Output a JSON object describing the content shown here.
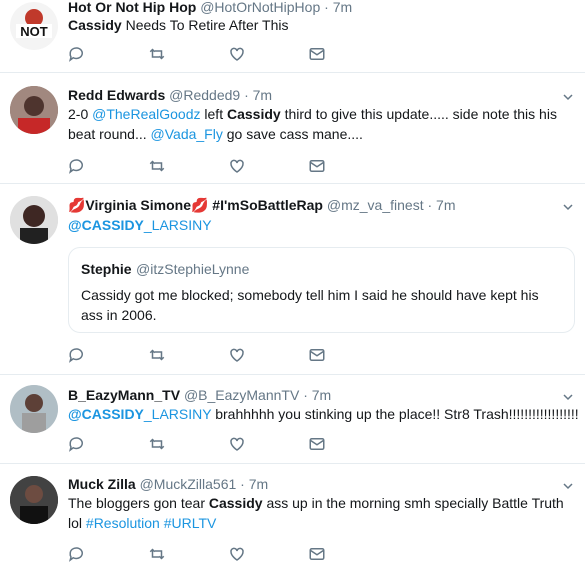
{
  "tweets": [
    {
      "name": "Hot Or Not Hip Hop",
      "handle": "@HotOrNotHipHop",
      "time": "7m",
      "avatar_text": "NOT",
      "body": [
        {
          "t": "Cassidy",
          "bold": true
        },
        {
          "t": " Needs To Retire After This"
        }
      ]
    },
    {
      "name": "Redd Edwards",
      "handle": "@Redded9",
      "time": "7m",
      "body": [
        {
          "t": "2-0 "
        },
        {
          "t": "@TheRealGoodz",
          "link": true
        },
        {
          "t": " left "
        },
        {
          "t": "Cassidy",
          "bold": true
        },
        {
          "t": " third to give this update..... side note this his beat round... "
        },
        {
          "t": "@Vada_Fly",
          "link": true
        },
        {
          "t": " go save cass mane...."
        }
      ]
    },
    {
      "name": "💋Virginia Simone💋 #I'mSoBattleRap",
      "handle": "@mz_va_finest",
      "time": "7m",
      "body": [
        {
          "t": "@CASSIDY",
          "link": true,
          "bold": true
        },
        {
          "t": "_LARSINY",
          "link": true
        }
      ],
      "quote": {
        "name": "Stephie",
        "handle": "@itzStephieLynne",
        "text": "Cassidy got me blocked; somebody tell him I said he should have kept his ass in 2006."
      }
    },
    {
      "name": "B_EazyMann_TV",
      "handle": "@B_EazyMannTV",
      "time": "7m",
      "body": [
        {
          "t": "@CASSIDY",
          "link": true,
          "bold": true
        },
        {
          "t": "_LARSINY",
          "link": true
        },
        {
          "t": " brahhhhh you stinking up the place!! Str8 Trash!!!!!!!!!!!!!!!!!!"
        }
      ]
    },
    {
      "name": "Muck Zilla",
      "handle": "@MuckZilla561",
      "time": "7m",
      "body": [
        {
          "t": "The bloggers gon tear "
        },
        {
          "t": "Cassidy",
          "bold": true
        },
        {
          "t": " ass up in the morning smh specially Battle Truth lol "
        },
        {
          "t": "#Resolution",
          "link": true
        },
        {
          "t": " "
        },
        {
          "t": "#URLTV",
          "link": true
        }
      ]
    }
  ],
  "separator": "·",
  "icons": [
    "reply-icon",
    "retweet-icon",
    "like-icon",
    "direct-message-icon",
    "caret-down-icon"
  ],
  "colors": {
    "link": "#1b95e0",
    "muted": "#657786",
    "border": "#e6ecf0"
  }
}
